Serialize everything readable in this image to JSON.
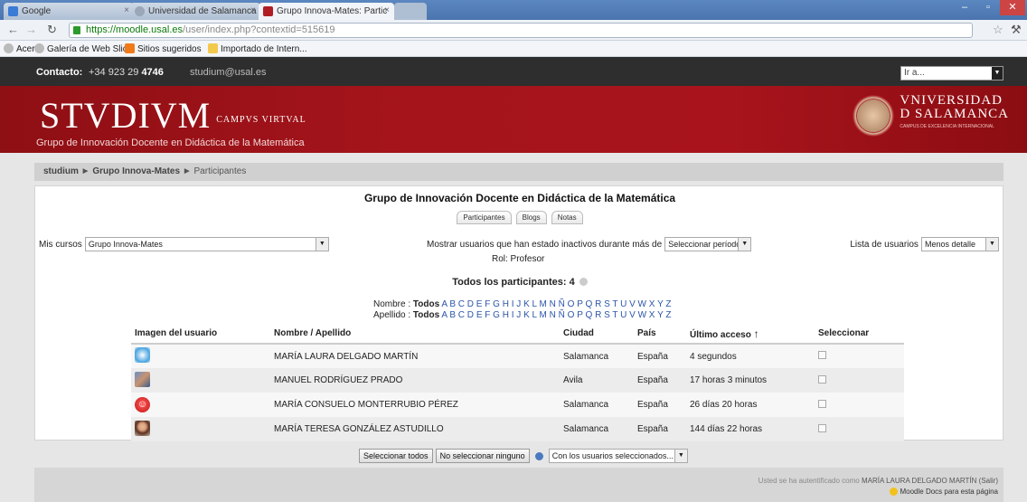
{
  "browser": {
    "tabs": [
      {
        "label": "Google"
      },
      {
        "label": "Universidad de Salamanca |"
      },
      {
        "label": "Grupo Innova-Mates: Partic"
      }
    ],
    "url_scheme": "https://",
    "url_host": "moodle.usal.es",
    "url_path": "/user/index.php?contextid=515619",
    "bookmarks": [
      "Acer",
      "Galería de Web Slice",
      "Sitios sugeridos",
      "Importado de Intern..."
    ]
  },
  "site": {
    "contact_label": "Contacto:",
    "contact_phone_prefix": "+34 923 29",
    "contact_phone_ext": "4746",
    "contact_email": "studium@usal.es",
    "goto_placeholder": "Ir a...",
    "logo_text": "STVDIVM",
    "logo_sub": "CAMPVS VIRTVAL",
    "subtitle": "Grupo de Innovación Docente en Didáctica de la Matemática",
    "uni_line1": "VNIVERSIDAD",
    "uni_line2": "D SALAMANCA",
    "uni_line3": "CAMPUS DE EXCELENCIA INTERNACIONAL"
  },
  "breadcrumb": [
    "studium",
    "Grupo Innova-Mates",
    "Participantes"
  ],
  "main": {
    "title": "Grupo de Innovación Docente en Didáctica de la Matemática",
    "tabs": [
      "Participantes",
      "Blogs",
      "Notas"
    ],
    "mis_cursos_label": "Mis cursos",
    "mis_cursos_value": "Grupo Innova-Mates",
    "inactive_label": "Mostrar usuarios que han estado inactivos durante más de",
    "inactive_value": "Seleccionar período",
    "role_label": "Rol: Profesor",
    "list_label": "Lista de usuarios",
    "list_value": "Menos detalle",
    "total_label": "Todos los participantes: 4",
    "nombre_label": "Nombre :",
    "apellido_label": "Apellido :",
    "todos": "Todos",
    "letters": [
      "A",
      "B",
      "C",
      "D",
      "E",
      "F",
      "G",
      "H",
      "I",
      "J",
      "K",
      "L",
      "M",
      "N",
      "Ñ",
      "O",
      "P",
      "Q",
      "R",
      "S",
      "T",
      "U",
      "V",
      "W",
      "X",
      "Y",
      "Z"
    ]
  },
  "table": {
    "headers": [
      "Imagen del usuario",
      "Nombre / Apellido",
      "Ciudad",
      "País",
      "Último acceso",
      "Seleccionar"
    ],
    "sort_icon": "arrow-up-icon",
    "rows": [
      {
        "name": "MARÍA LAURA DELGADO MARTÍN",
        "city": "Salamanca",
        "country": "España",
        "access": "4 segundos",
        "avatar": "snowflake-avatar"
      },
      {
        "name": "MANUEL RODRÍGUEZ PRADO",
        "city": "Avila",
        "country": "España",
        "access": "17 horas 3 minutos",
        "avatar": "photo-avatar"
      },
      {
        "name": "MARÍA CONSUELO MONTERRUBIO PÉREZ",
        "city": "Salamanca",
        "country": "España",
        "access": "26 días 20 horas",
        "avatar": "smiley-avatar"
      },
      {
        "name": "MARÍA TERESA GONZÁLEZ ASTUDILLO",
        "city": "Salamanca",
        "country": "España",
        "access": "144 días 22 horas",
        "avatar": "woman-avatar"
      }
    ]
  },
  "actions": {
    "select_all": "Seleccionar todos",
    "select_none": "No seleccionar ninguno",
    "with_selected": "Con los usuarios seleccionados..."
  },
  "footer": {
    "auth_text": "Usted se ha autentificado como",
    "user_name": "MARÍA LAURA DELGADO MARTÍN",
    "logout": "(Salir)",
    "docs": "Moodle Docs para esta página"
  },
  "colors": {
    "brand_red": "#a5141b",
    "link_blue": "#2b55a7"
  }
}
